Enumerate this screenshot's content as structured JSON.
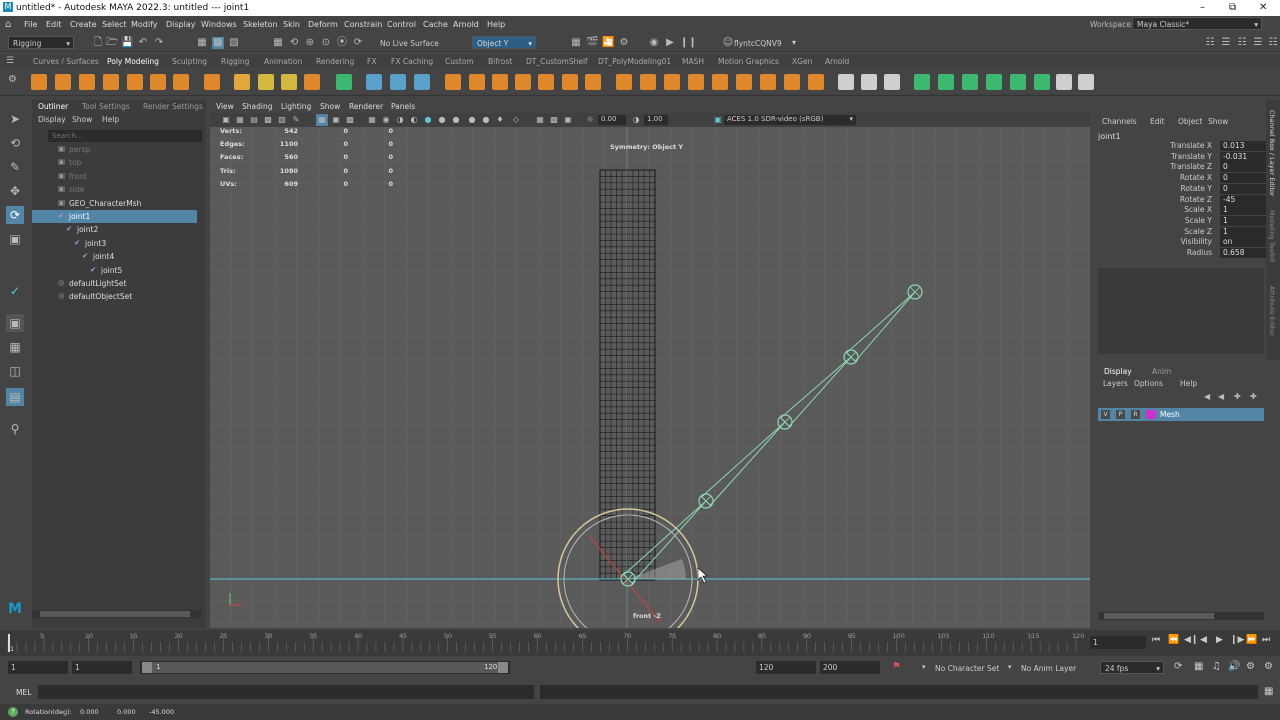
{
  "window": {
    "title": "untitled* - Autodesk MAYA 2022.3: untitled   ---   joint1"
  },
  "menu": [
    "File",
    "Edit",
    "Create",
    "Select",
    "Modify",
    "Display",
    "Windows",
    "Skeleton",
    "Skin",
    "Deform",
    "Constrain",
    "Control",
    "Cache",
    "Arnold",
    "Help"
  ],
  "workspace": {
    "label": "Workspace:",
    "value": "Maya Classic*"
  },
  "status": {
    "menuset": "Rigging",
    "live_surface": "No Live Surface",
    "symmetry": "Object Y",
    "user": "flyntcCQNV9"
  },
  "shelf_tabs": [
    "Curves / Surfaces",
    "Poly Modeling",
    "Sculpting",
    "Rigging",
    "Animation",
    "Rendering",
    "FX",
    "FX Caching",
    "Custom",
    "Bifrost",
    "DT_CustomShelf",
    "DT_PolyModeling01",
    "MASH",
    "Motion Graphics",
    "XGen",
    "Arnold"
  ],
  "shelf_active": "Poly Modeling",
  "outliner": {
    "tabs": [
      "Outliner",
      "Tool Settings",
      "Render Settings"
    ],
    "menu": [
      "Display",
      "Show",
      "Help"
    ],
    "search_placeholder": "Search...",
    "items": [
      {
        "label": "persp",
        "dim": true,
        "indent": 0
      },
      {
        "label": "top",
        "dim": true,
        "indent": 0
      },
      {
        "label": "front",
        "dim": true,
        "indent": 0
      },
      {
        "label": "side",
        "dim": true,
        "indent": 0
      },
      {
        "label": "GEO_CharacterMsh",
        "dim": false,
        "indent": 0
      },
      {
        "label": "joint1",
        "dim": false,
        "indent": 0,
        "selected": true
      },
      {
        "label": "joint2",
        "dim": false,
        "indent": 1
      },
      {
        "label": "joint3",
        "dim": false,
        "indent": 2
      },
      {
        "label": "joint4",
        "dim": false,
        "indent": 3
      },
      {
        "label": "joint5",
        "dim": false,
        "indent": 4
      },
      {
        "label": "defaultLightSet",
        "dim": false,
        "indent": 0
      },
      {
        "label": "defaultObjectSet",
        "dim": false,
        "indent": 0
      }
    ]
  },
  "viewport": {
    "menu": [
      "View",
      "Shading",
      "Lighting",
      "Show",
      "Renderer",
      "Panels"
    ],
    "exposure": "0.00",
    "gamma": "1.00",
    "colorspace": "ACES 1.0 SDR-video (sRGB)",
    "symmetry_label": "Symmetry: Object Y",
    "camera_label": "front -Z",
    "stats": [
      {
        "label": "Verts:",
        "a": "542",
        "b": "0",
        "c": "0"
      },
      {
        "label": "Edges:",
        "a": "1100",
        "b": "0",
        "c": "0"
      },
      {
        "label": "Faces:",
        "a": "560",
        "b": "0",
        "c": "0"
      },
      {
        "label": "Tris:",
        "a": "1080",
        "b": "0",
        "c": "0"
      },
      {
        "label": "UVs:",
        "a": "609",
        "b": "0",
        "c": "0"
      }
    ]
  },
  "channel_box": {
    "menu": [
      "Channels",
      "Edit",
      "Object",
      "Show"
    ],
    "object": "joint1",
    "channels": [
      {
        "label": "Translate X",
        "value": "0.013"
      },
      {
        "label": "Translate Y",
        "value": "-0.031"
      },
      {
        "label": "Translate Z",
        "value": "0"
      },
      {
        "label": "Rotate X",
        "value": "0"
      },
      {
        "label": "Rotate Y",
        "value": "0"
      },
      {
        "label": "Rotate Z",
        "value": "-45"
      },
      {
        "label": "Scale X",
        "value": "1"
      },
      {
        "label": "Scale Y",
        "value": "1"
      },
      {
        "label": "Scale Z",
        "value": "1"
      },
      {
        "label": "Visibility",
        "value": "on"
      },
      {
        "label": "Radius",
        "value": "0.658"
      }
    ],
    "layer_tabs": [
      "Display",
      "Anim"
    ],
    "layer_menu": [
      "Layers",
      "Options",
      "Help"
    ],
    "layer": {
      "v": "V",
      "p": "P",
      "r": "R",
      "name": "Mesh"
    },
    "side_tabs": [
      "Channel Box / Layer Editor",
      "Modeling Toolkit",
      "Attribute Editor"
    ]
  },
  "timeline": {
    "ticks": [
      "5",
      "10",
      "15",
      "20",
      "25",
      "30",
      "35",
      "40",
      "45",
      "50",
      "55",
      "60",
      "65",
      "70",
      "75",
      "80",
      "85",
      "90",
      "95",
      "100",
      "105",
      "110",
      "115",
      "120"
    ],
    "current_frame": "1",
    "range_start": "1",
    "range_start_inner": "1",
    "range_slider_start": "1",
    "range_slider_end": "120",
    "range_end_inner": "120",
    "range_end": "200",
    "character_set": "No Character Set",
    "anim_layer": "No Anim Layer",
    "fps": "24 fps"
  },
  "cmdline": {
    "label": "MEL"
  },
  "helpline": {
    "text": "Rotation(deg):",
    "x": "0.000",
    "y": "0.000",
    "z": "-45.000"
  },
  "colors": {
    "selection": "#5285a6",
    "joint": "#8cd9b0",
    "mesh_layer": "#cc33cc",
    "cyan_axis": "#5fc8d8"
  }
}
